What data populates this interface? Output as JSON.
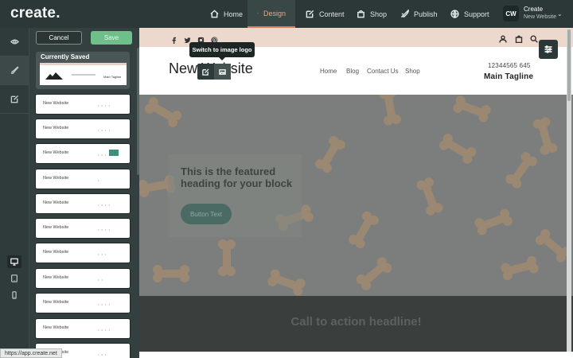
{
  "app": {
    "logo": "create."
  },
  "nav": {
    "items": [
      {
        "label": "Home",
        "icon": "home-icon"
      },
      {
        "label": "Design",
        "icon": "brush-icon",
        "active": true
      },
      {
        "label": "Content",
        "icon": "edit-icon"
      },
      {
        "label": "Shop",
        "icon": "bag-icon"
      },
      {
        "label": "Publish",
        "icon": "rocket-icon"
      },
      {
        "label": "Support",
        "icon": "globe-icon"
      }
    ],
    "accent": "#e07a55"
  },
  "account": {
    "initials": "CW",
    "name": "Create",
    "site": "New Website"
  },
  "panel": {
    "cancel_label": "Cancel",
    "save_label": "Save",
    "current_label": "Currently Saved",
    "current_thumb_tagline": "Main Tagline",
    "templates": [
      "New Website",
      "New Website",
      "New Website",
      "New Website",
      "New Website",
      "New Website",
      "New Website",
      "New Website",
      "New Website",
      "New Website",
      "New Website"
    ]
  },
  "site": {
    "logo_text": "New Website",
    "nav": [
      "Home",
      "Blog",
      "Contact Us",
      "Shop"
    ],
    "phone": "12344565 645",
    "tagline": "Main Tagline",
    "tooltip": "Switch to image logo",
    "hero_heading": "This is the featured heading for your block",
    "hero_button": "Button Text",
    "cta_headline": "Call to action headline!"
  },
  "status_url": "https://app.create.net"
}
